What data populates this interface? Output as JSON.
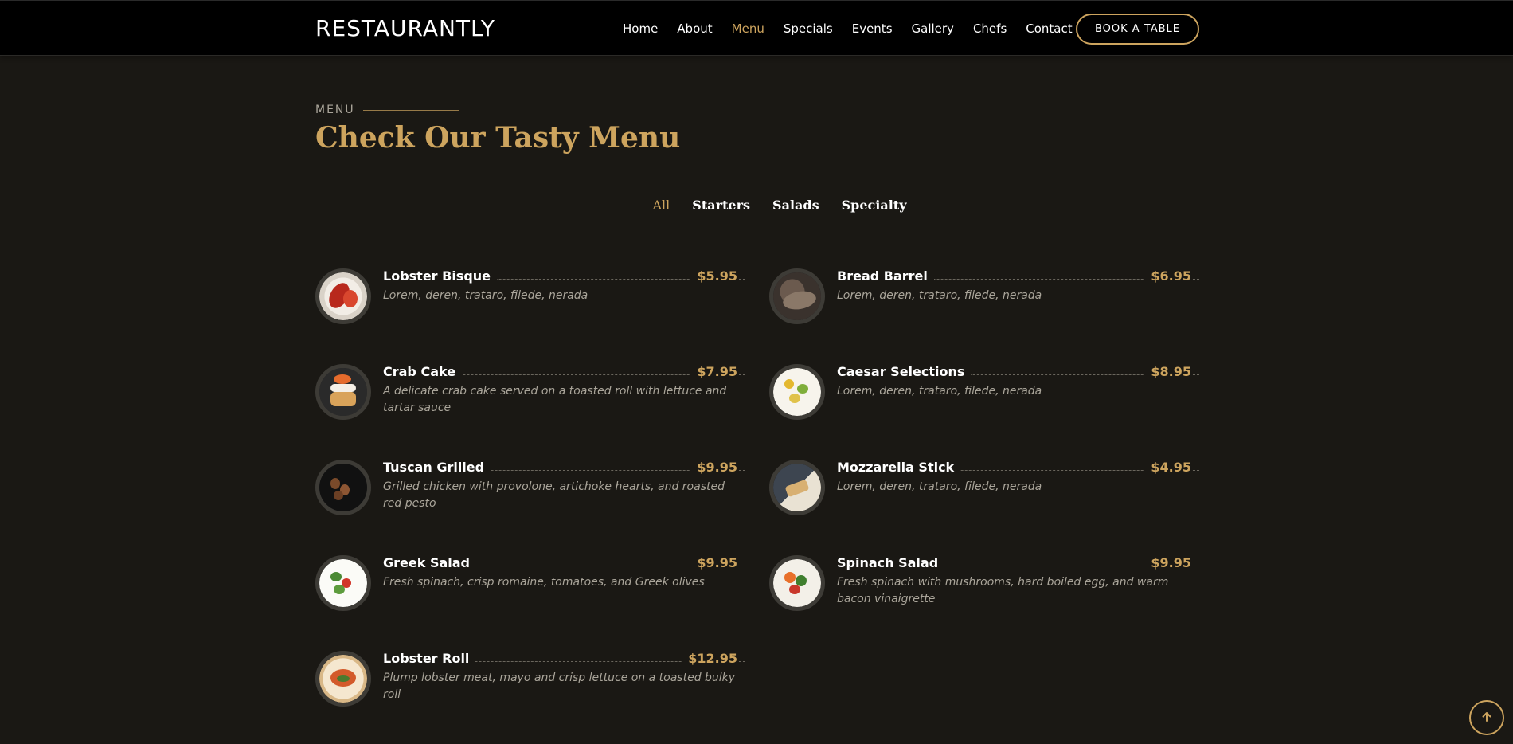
{
  "header": {
    "logo": "RESTAURANTLY",
    "nav": [
      "Home",
      "About",
      "Menu",
      "Specials",
      "Events",
      "Gallery",
      "Chefs",
      "Contact"
    ],
    "active_nav": "Menu",
    "book_button": "BOOK A TABLE"
  },
  "section": {
    "label": "MENU",
    "title": "Check Our Tasty Menu"
  },
  "filters": [
    "All",
    "Starters",
    "Salads",
    "Specialty"
  ],
  "active_filter": "All",
  "menu": [
    {
      "name": "Lobster Bisque",
      "price": "$5.95",
      "desc": "Lorem, deren, trataro, filede, nerada",
      "image": "lobster-bisque-image"
    },
    {
      "name": "Bread Barrel",
      "price": "$6.95",
      "desc": "Lorem, deren, trataro, filede, nerada",
      "image": "bread-barrel-image"
    },
    {
      "name": "Crab Cake",
      "price": "$7.95",
      "desc": "A delicate crab cake served on a toasted roll with lettuce and tartar sauce",
      "image": "crab-cake-image"
    },
    {
      "name": "Caesar Selections",
      "price": "$8.95",
      "desc": "Lorem, deren, trataro, filede, nerada",
      "image": "caesar-selections-image"
    },
    {
      "name": "Tuscan Grilled",
      "price": "$9.95",
      "desc": "Grilled chicken with provolone, artichoke hearts, and roasted red pesto",
      "image": "tuscan-grilled-image"
    },
    {
      "name": "Mozzarella Stick",
      "price": "$4.95",
      "desc": "Lorem, deren, trataro, filede, nerada",
      "image": "mozzarella-stick-image"
    },
    {
      "name": "Greek Salad",
      "price": "$9.95",
      "desc": "Fresh spinach, crisp romaine, tomatoes, and Greek olives",
      "image": "greek-salad-image"
    },
    {
      "name": "Spinach Salad",
      "price": "$9.95",
      "desc": "Fresh spinach with mushrooms, hard boiled egg, and warm bacon vinaigrette",
      "image": "spinach-salad-image"
    },
    {
      "name": "Lobster Roll",
      "price": "$12.95",
      "desc": "Plump lobster meat, mayo and crisp lettuce on a toasted bulky roll",
      "image": "lobster-roll-image"
    }
  ],
  "colors": {
    "accent": "#cda45e",
    "background": "#1a1814",
    "header_bg": "#000000",
    "muted_text": "#aaa59a"
  },
  "scroll_top_icon": "arrow-up-icon"
}
